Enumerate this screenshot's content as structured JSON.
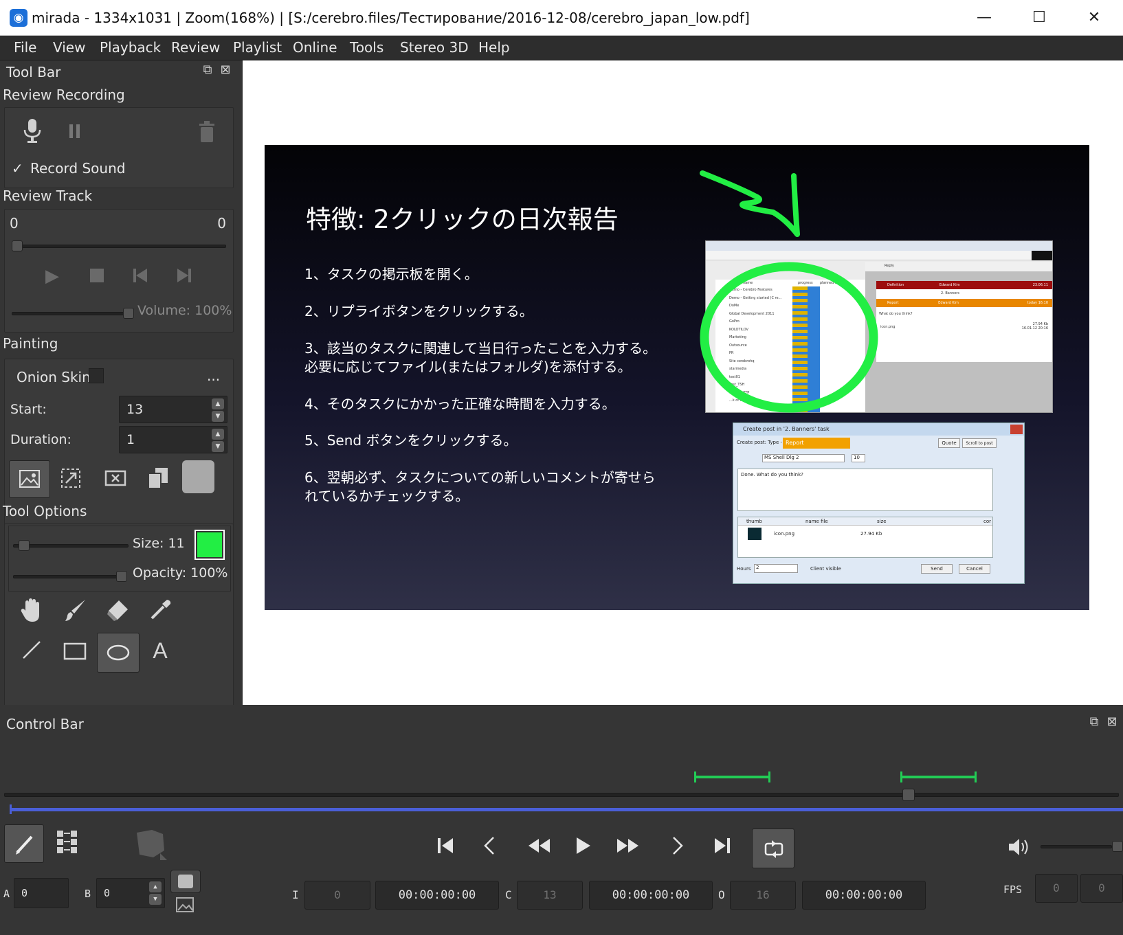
{
  "window": {
    "title": "mirada - 1334x1031 | Zoom(168%) | [S:/cerebro.files/Тестирование/2016-12-08/cerebro_japan_low.pdf]"
  },
  "menu": [
    "File",
    "View",
    "Playback",
    "Review",
    "Playlist",
    "Online",
    "Tools",
    "Stereo 3D",
    "Help"
  ],
  "toolbar": {
    "title": "Tool Bar"
  },
  "review_recording": {
    "title": "Review Recording",
    "record_sound": "Record Sound",
    "checkmark": "✓"
  },
  "review_track": {
    "title": "Review Track",
    "start": "0",
    "end": "0",
    "volume": "Volume: 100%",
    "progress": 0.0,
    "volume_level": 1.0
  },
  "painting": {
    "title": "Painting",
    "onion_skin": "Onion Skin",
    "more": "...",
    "start_label": "Start:",
    "start_value": "13",
    "duration_label": "Duration:",
    "duration_value": "1"
  },
  "tool_options": {
    "title": "Tool Options",
    "size": "Size: 11",
    "opacity": "Opacity: 100%",
    "color": "#22ee44"
  },
  "slide": {
    "title": "特徴: 2クリックの日次報告",
    "lines": [
      "1、タスクの掲示板を開く。",
      "2、リプライボタンをクリックする。",
      "3、該当のタスクに関連して当日行ったことを入力する。",
      "必要に応じてファイル(またはフォルダ)を添付する。",
      "4、そのタスクにかかった正確な時間を入力する。",
      "5、Send ボタンをクリックする。",
      "6、翌朝必ず、タスクについての新しいコメントが寄せら",
      "れているかチェックする。"
    ],
    "annotation_color": "#22ee44",
    "dialog": {
      "title": "Create post in '2. Banners' task",
      "type_label": "Create post: Type -",
      "type_value": "Report",
      "quote": "Quote",
      "scroll": "Scroll to post",
      "font": "MS Shell Dlg 2",
      "font_size": "10",
      "body": "Done. What do you think?",
      "col_thumb": "thumb",
      "col_name": "name file",
      "col_size": "size",
      "col_cor": "cor",
      "file_name": "icon.png",
      "file_size": "27.94 Kb",
      "hours_label": "Hours",
      "hours_value": "2",
      "client_visible": "Client visible",
      "send": "Send",
      "cancel": "Cancel"
    },
    "board": {
      "name_col": "name",
      "progress_col": "progress",
      "planned_col": "planned cost",
      "reply": "Reply",
      "definition": "Definition",
      "report": "Report",
      "edward": "Edward Kim",
      "date": "23.06.11",
      "banners": "2. Banners",
      "today": "today 16:10",
      "what": "What do you think?",
      "icon_png": "icon.png",
      "size": "27.94 Kb",
      "date2": "16.01.12 20:16",
      "rows": [
        "Demo - Cerebro Features",
        "Demo - Getting started (C re...",
        "DoMe",
        "Global Development 2011",
        "GoPro",
        "KOLOTILOV",
        "Marketing",
        "Outsource",
        "PR",
        "Site cerebrohq",
        "starmedia",
        "test01",
        "Test_TSH",
        "Wreath_FTP",
        "...k of images"
      ]
    }
  },
  "control": {
    "title": "Control Bar",
    "a_label": "A",
    "a_value": "0",
    "b_label": "B",
    "b_value": "0",
    "i_label": "I",
    "i_frame": "0",
    "i_tc": "00:00:00:00",
    "c_label": "C",
    "c_frame": "13",
    "c_tc": "00:00:00:00",
    "o_label": "O",
    "o_frame": "16",
    "o_tc": "00:00:00:00",
    "fps_label": "FPS",
    "fps1": "0",
    "fps2": "0",
    "timeline_position": 0.815,
    "volume_level": 1.0
  },
  "colors": {
    "accent": "#4a5fd8",
    "green": "#22cc55",
    "annotation": "#22ee44"
  }
}
